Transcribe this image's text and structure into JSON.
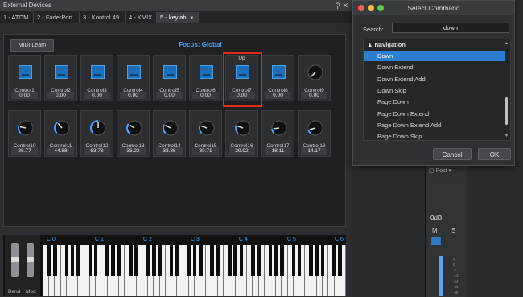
{
  "window": {
    "title": "External Devices"
  },
  "tabs": [
    {
      "label": "1 - ATOM"
    },
    {
      "label": "2 - FaderPort"
    },
    {
      "label": "3 - Kontrol 49"
    },
    {
      "label": "4 - KMIX"
    },
    {
      "label": "5 - keylab"
    }
  ],
  "panel": {
    "midi_learn": "MIDI Learn",
    "focus": "Focus: Global",
    "row1": [
      {
        "name": "Control1",
        "value": "0.00",
        "type": "button"
      },
      {
        "name": "Control2",
        "value": "0.00",
        "type": "button"
      },
      {
        "name": "Control3",
        "value": "0.00",
        "type": "button"
      },
      {
        "name": "Control4",
        "value": "0.00",
        "type": "button"
      },
      {
        "name": "Control5",
        "value": "0.00",
        "type": "button"
      },
      {
        "name": "Control6",
        "value": "0.00",
        "type": "button"
      },
      {
        "name": "Control7",
        "value": "0.00",
        "type": "button",
        "assigned": "Up"
      },
      {
        "name": "Control8",
        "value": "0.00",
        "type": "button"
      },
      {
        "name": "Control9",
        "value": "0.00",
        "type": "knob"
      }
    ],
    "row2": [
      {
        "name": "Control10",
        "value": "26.77"
      },
      {
        "name": "Control11",
        "value": "44.88"
      },
      {
        "name": "Control12",
        "value": "63.78"
      },
      {
        "name": "Control13",
        "value": "36.22"
      },
      {
        "name": "Control14",
        "value": "33.86"
      },
      {
        "name": "Control15",
        "value": "30.71"
      },
      {
        "name": "Control16",
        "value": "29.92"
      },
      {
        "name": "Control17",
        "value": "18.11"
      },
      {
        "name": "Control18",
        "value": "14.17"
      }
    ]
  },
  "keyboard": {
    "bend_label": "Bend",
    "mod_label": "Mod",
    "octaves": [
      "C 0",
      "C 1",
      "C 2",
      "C 3",
      "C 4",
      "C 5",
      "C 6"
    ]
  },
  "mixer": {
    "post": "Post",
    "volume": "0dB",
    "mute": "M",
    "solo": "S",
    "scale": [
      "6",
      "0",
      "-6",
      "-12",
      "-24",
      "-36",
      "-48"
    ]
  },
  "dialog": {
    "title": "Select Command",
    "search_label": "Search:",
    "search_value": "down",
    "category": "Navigation",
    "items": [
      "Down",
      "Down Extend",
      "Down Extend Add",
      "Down Skip",
      "Page Down",
      "Page Down Extend",
      "Page Down Extend Add",
      "Page Down Skip"
    ],
    "selected_index": 0,
    "cancel": "Cancel",
    "ok": "OK"
  },
  "colors": {
    "accent": "#3fa3ff",
    "selection": "#2f7fd0",
    "highlight_box": "#e32b1c",
    "button_blue": "#1e6fb8"
  }
}
